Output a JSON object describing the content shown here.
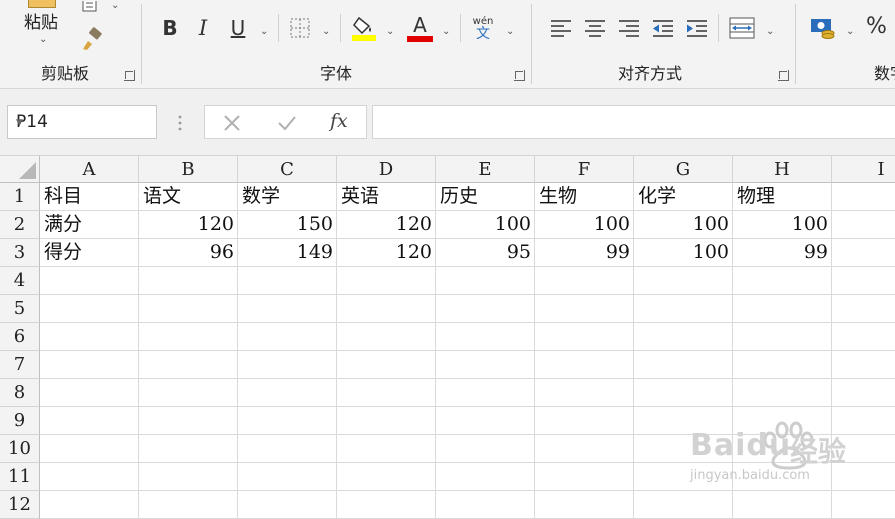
{
  "ribbon": {
    "clipboard": {
      "paste_label": "粘贴",
      "group_label": "剪贴板"
    },
    "font": {
      "group_label": "字体",
      "bold": "B",
      "italic": "I",
      "underline": "U",
      "font_color_glyph": "A",
      "phonetic_top": "wén",
      "phonetic_bottom": "文",
      "fill_color": "#ffff00",
      "font_color": "#e00000"
    },
    "alignment": {
      "group_label": "对齐方式"
    },
    "number": {
      "group_label": "数字",
      "percent": "%"
    }
  },
  "formula_bar": {
    "name_box": "P14",
    "fx_label": "fx",
    "formula": ""
  },
  "sheet": {
    "columns": [
      "A",
      "B",
      "C",
      "D",
      "E",
      "F",
      "G",
      "H",
      "I"
    ],
    "rows": [
      "1",
      "2",
      "3",
      "4",
      "5",
      "6",
      "7",
      "8",
      "9",
      "10",
      "11",
      "12"
    ],
    "row1": [
      "科目",
      "语文",
      "数学",
      "英语",
      "历史",
      "生物",
      "化学",
      "物理"
    ],
    "row2": [
      "满分",
      "120",
      "150",
      "120",
      "100",
      "100",
      "100",
      "100"
    ],
    "row3": [
      "得分",
      "96",
      "149",
      "120",
      "95",
      "99",
      "100",
      "99"
    ]
  },
  "watermark": {
    "brand": "Baidu",
    "brand_cn": "经验",
    "url": "jingyan.baidu.com"
  }
}
